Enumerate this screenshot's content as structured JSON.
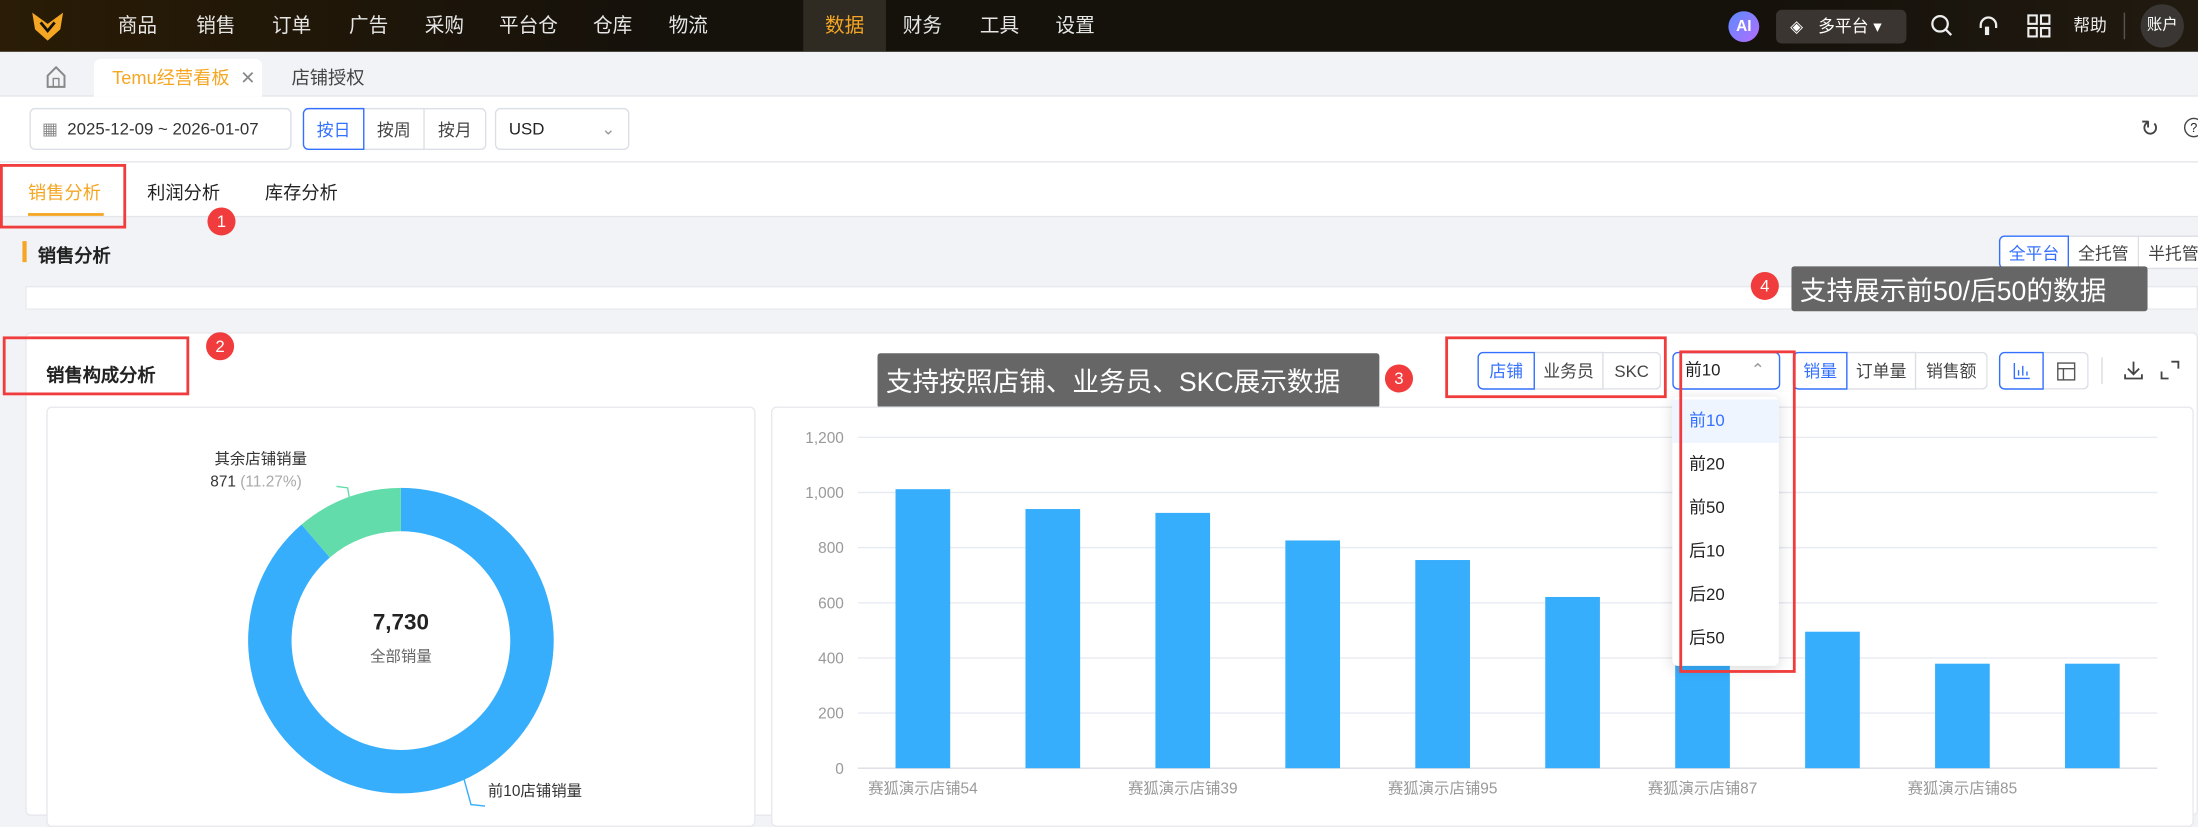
{
  "topnav": {
    "items": [
      "商品",
      "销售",
      "订单",
      "广告",
      "采购",
      "平台仓",
      "仓库",
      "物流",
      "数据",
      "财务",
      "工具",
      "设置"
    ],
    "active": "数据",
    "ai": "AI",
    "platform": "多平台",
    "help": "帮助",
    "account": "账户"
  },
  "tabs": {
    "home": "home",
    "items": [
      {
        "label": "Temu经营看板",
        "close": "✕"
      },
      {
        "label": "店铺授权"
      }
    ]
  },
  "filters": {
    "date_range": "2025-12-09 ~ 2026-01-07",
    "granularity": [
      "按日",
      "按周",
      "按月"
    ],
    "currency": "USD"
  },
  "analysis_tabs": [
    "销售分析",
    "利润分析",
    "库存分析"
  ],
  "section": {
    "title": "销售分析",
    "platform_buttons": [
      "全平台",
      "全托管",
      "半托管"
    ]
  },
  "composition": {
    "title": "销售构成分析",
    "dimension_buttons": [
      "店铺",
      "业务员",
      "SKC"
    ],
    "range_select": "前10",
    "range_options": [
      "前10",
      "前20",
      "前50",
      "后10",
      "后20",
      "后50"
    ],
    "metric_buttons": [
      "销量",
      "订单量",
      "销售额"
    ]
  },
  "annotations": {
    "b1": "1",
    "b2": "2",
    "b3": "3",
    "b4": "4",
    "tip3": "支持按照店铺、业务员、SKC展示数据",
    "tip4": "支持展示前50/后50的数据"
  },
  "donut": {
    "total": "7,730",
    "total_label": "全部销量",
    "others_label": "其余店铺销量",
    "others_value": "871",
    "others_pct": "(11.27%)",
    "top_label": "前10店铺销量",
    "colors": {
      "top": "#36aefc",
      "others": "#62dcaa"
    }
  },
  "chart_data": {
    "type": "bar",
    "title": "",
    "xlabel": "",
    "ylabel": "",
    "ylim": [
      0,
      1200
    ],
    "yticks": [
      "0",
      "200",
      "400",
      "600",
      "800",
      "1,000",
      "1,200"
    ],
    "categories": [
      "赛狐演示店铺54",
      "",
      "赛狐演示店铺39",
      "",
      "赛狐演示店铺95",
      "",
      "赛狐演示店铺87",
      "",
      "赛狐演示店铺85",
      ""
    ],
    "values": [
      1012,
      940,
      926,
      826,
      755,
      621,
      529,
      495,
      379,
      379
    ],
    "color": "#36aefc",
    "grid": true
  }
}
